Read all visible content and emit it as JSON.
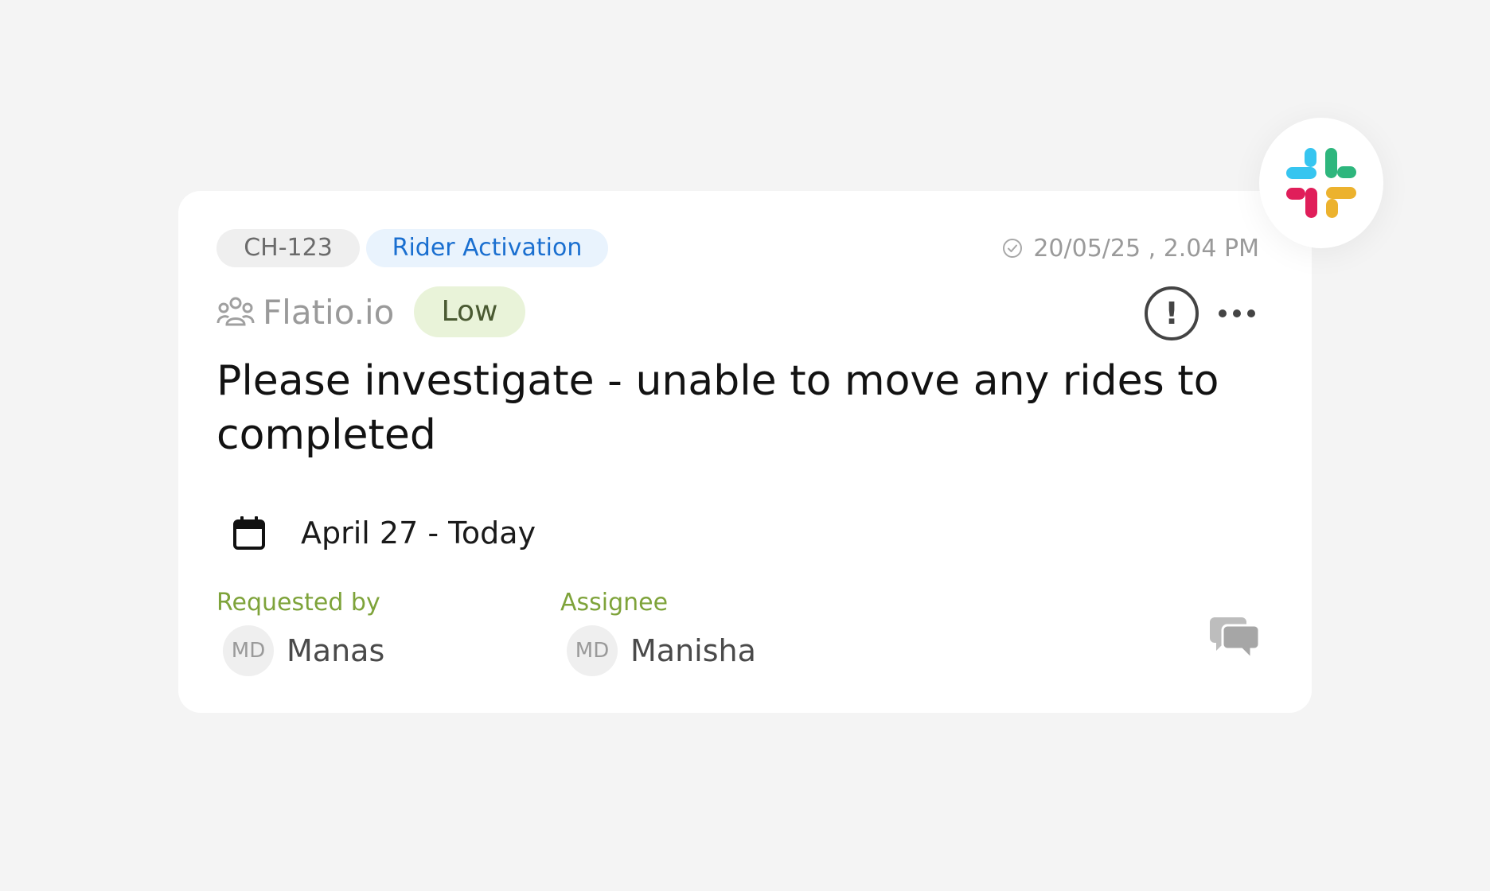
{
  "ticket": {
    "id": "CH-123",
    "category": "Rider Activation",
    "timestamp": "20/05/25 , 2.04 PM",
    "organization": "Flatio.io",
    "priority": "Low",
    "title": "Please investigate - unable to move any rides to completed",
    "date_range": "April 27 - Today"
  },
  "people": {
    "requested_by": {
      "label": "Requested by",
      "initials": "MD",
      "name": "Manas"
    },
    "assignee": {
      "label": "Assignee",
      "initials": "MD",
      "name": "Manisha"
    }
  },
  "icons": {
    "timestamp": "check-circle-icon",
    "organization": "team-icon",
    "alert": "exclamation-circle-icon",
    "more": "more-horizontal-icon",
    "calendar": "calendar-icon",
    "comments": "chat-bubbles-icon",
    "integration": "slack-logo-icon"
  },
  "colors": {
    "tag_category_bg": "#e9f3fd",
    "tag_category_text": "#1a6fd0",
    "priority_bg": "#e9f3d9",
    "label_green": "#7ea33a",
    "slack_blue": "#36C5F0",
    "slack_green": "#2EB67D",
    "slack_red": "#E01E5A",
    "slack_yellow": "#ECB22E"
  }
}
